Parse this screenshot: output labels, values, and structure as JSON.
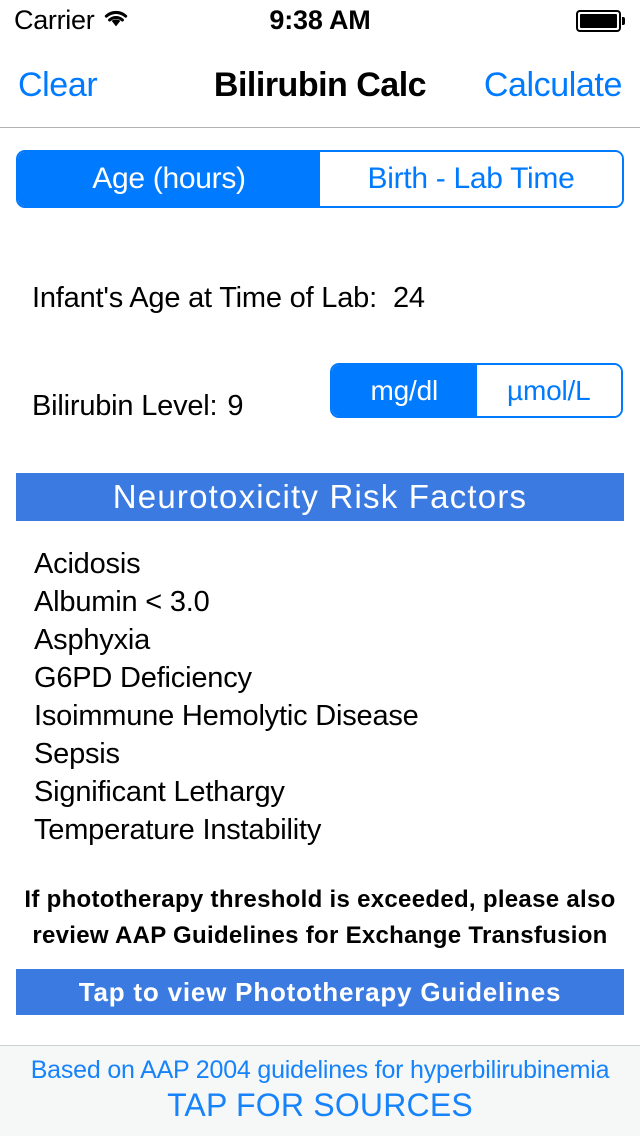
{
  "status_bar": {
    "carrier": "Carrier",
    "wifi_icon": "wifi-icon",
    "time": "9:38 AM",
    "battery_icon": "battery-full-icon"
  },
  "nav_bar": {
    "left_button": "Clear",
    "title": "Bilirubin Calc",
    "right_button": "Calculate"
  },
  "mode_selector": {
    "options": [
      {
        "label": "Age (hours)",
        "selected": true
      },
      {
        "label": "Birth - Lab Time",
        "selected": false
      }
    ]
  },
  "fields": {
    "age": {
      "label": "Infant's Age at Time of Lab:",
      "value": "24",
      "placeholder": "hours"
    },
    "bilirubin": {
      "label": "Bilirubin Level:",
      "value": "9",
      "placeholder": "level"
    }
  },
  "unit_selector": {
    "options": [
      {
        "label": "mg/dl",
        "selected": true
      },
      {
        "label": "µmol/L",
        "selected": false
      }
    ]
  },
  "risk_section": {
    "header": "Neurotoxicity  Risk  Factors",
    "items": [
      "Acidosis",
      "Albumin < 3.0",
      "Asphyxia",
      "G6PD Deficiency",
      "Isoimmune Hemolytic Disease",
      "Sepsis",
      "Significant Lethargy",
      "Temperature Instability"
    ]
  },
  "note": {
    "line1": "If phototherapy threshold is exceeded, please also",
    "line2": "review AAP  Guidelines  for  Exchange  Transfusion"
  },
  "action_button": {
    "label": "Tap  to  view  Phototherapy  Guidelines"
  },
  "footer": {
    "line1": "Based on AAP 2004 guidelines for hyperbilirubinemia",
    "line2": "TAP FOR SOURCES"
  },
  "colors": {
    "ios_blue": "#007aff",
    "bar_blue": "#3b7ae0",
    "link_blue": "#1683fb",
    "footer_bg": "#f6f7f7",
    "text": "#000000"
  }
}
